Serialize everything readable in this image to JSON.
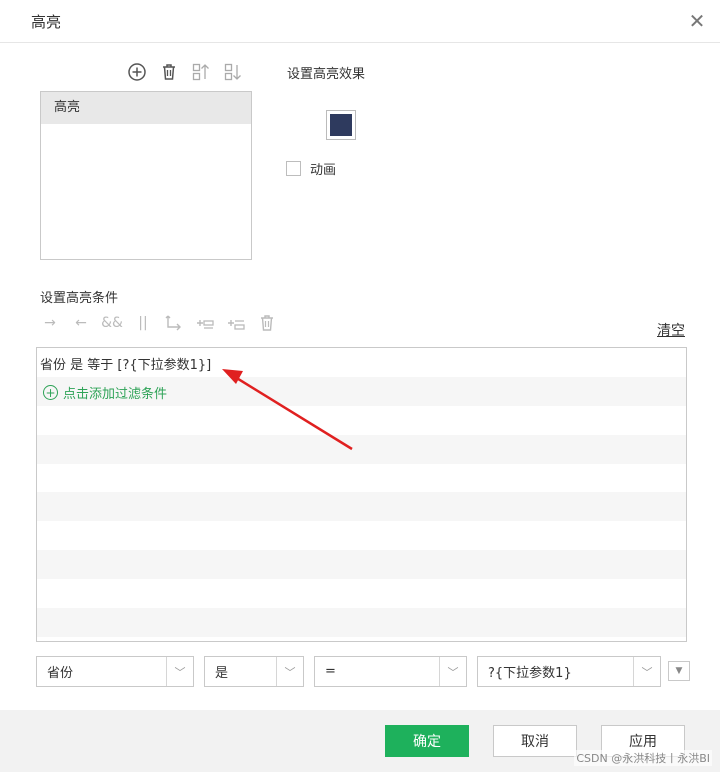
{
  "dialog": {
    "title": "高亮"
  },
  "highlight_list": {
    "items": [
      {
        "label": "高亮"
      }
    ]
  },
  "effect": {
    "title": "设置高亮效果",
    "color": "#2e3a5e",
    "animation_label": "动画",
    "animation_checked": false
  },
  "condition": {
    "title": "设置高亮条件",
    "clear_label": "清空",
    "expression": "省份 是 等于 [?{下拉参数1}]",
    "add_filter_label": "点击添加过滤条件",
    "toolbar": [
      "→",
      "←",
      "&&",
      "||"
    ]
  },
  "editor": {
    "field": "省份",
    "operator_is": "是",
    "operator": "=",
    "value": "?{下拉参数1}"
  },
  "buttons": {
    "ok": "确定",
    "cancel": "取消",
    "apply": "应用"
  },
  "watermark": "CSDN @永洪科技丨永洪BI",
  "colors": {
    "primary": "#1eb15c",
    "add_filter": "#2ea357",
    "arrow": "#e02020"
  }
}
